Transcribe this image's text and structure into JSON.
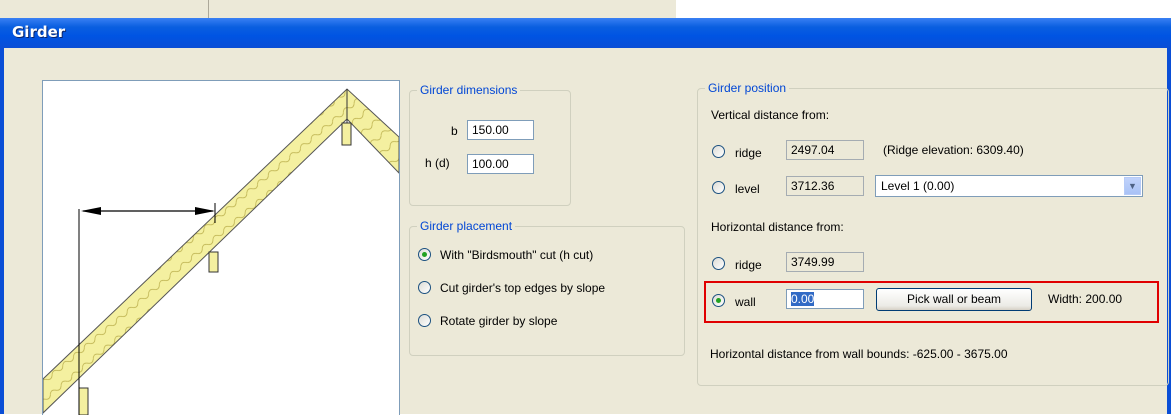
{
  "window": {
    "title": "Girder"
  },
  "dimensions": {
    "legend": "Girder dimensions",
    "b_label": "b",
    "b_value": "150.00",
    "h_label": "h (d)",
    "h_value": "100.00"
  },
  "placement": {
    "legend": "Girder placement",
    "options": [
      {
        "label": "With \"Birdsmouth\" cut (h cut)",
        "selected": true
      },
      {
        "label": "Cut girder's top edges by slope",
        "selected": false
      },
      {
        "label": "Rotate girder by slope",
        "selected": false
      }
    ]
  },
  "position": {
    "legend": "Girder position",
    "vertical_label": "Vertical distance from:",
    "v_ridge_label": "ridge",
    "v_ridge_value": "2497.04",
    "ridge_elevation_note": "(Ridge elevation: 6309.40)",
    "v_level_label": "level",
    "v_level_value": "3712.36",
    "level_select": "Level 1 (0.00)",
    "horizontal_label": "Horizontal distance from:",
    "h_ridge_label": "ridge",
    "h_ridge_value": "3749.99",
    "wall_label": "wall",
    "wall_value": "0.00",
    "pick_button": "Pick wall or beam",
    "width_text": "Width: 200.00",
    "bounds_text": "Horizontal distance from wall bounds: -625.00 - 3675.00"
  },
  "colors": {
    "highlight": "#e00000",
    "legend": "#0046d5",
    "radio_dot": "#21a121",
    "wood": "#f2ee96"
  }
}
